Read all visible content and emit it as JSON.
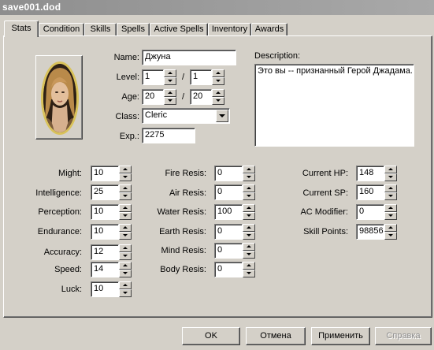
{
  "window": {
    "title": "save001.dod"
  },
  "tabs": [
    {
      "label": "Stats"
    },
    {
      "label": "Condition"
    },
    {
      "label": "Skills"
    },
    {
      "label": "Spells"
    },
    {
      "label": "Active Spells"
    },
    {
      "label": "Inventory"
    },
    {
      "label": "Awards"
    }
  ],
  "active_tab": "Stats",
  "character": {
    "name_label": "Name:",
    "name": "Джуна",
    "level_label": "Level:",
    "level": "1",
    "level_sep": "/",
    "level_max": "1",
    "age_label": "Age:",
    "age": "20",
    "age_sep": "/",
    "age_max": "20",
    "class_label": "Class:",
    "class": "Cleric",
    "exp_label": "Exp.:",
    "exp": "2275"
  },
  "description": {
    "label": "Description:",
    "text": "Это вы -- признанный Герой Джадама."
  },
  "attributes": [
    {
      "label": "Might:",
      "value": "10"
    },
    {
      "label": "Intelligence:",
      "value": "25"
    },
    {
      "label": "Perception:",
      "value": "10"
    },
    {
      "label": "Endurance:",
      "value": "10"
    },
    {
      "label": "Accuracy:",
      "value": "12"
    },
    {
      "label": "Speed:",
      "value": "14"
    },
    {
      "label": "Luck:",
      "value": "10"
    }
  ],
  "resistances": [
    {
      "label": "Fire Resis:",
      "value": "0"
    },
    {
      "label": "Air Resis:",
      "value": "0"
    },
    {
      "label": "Water Resis:",
      "value": "100"
    },
    {
      "label": "Earth Resis:",
      "value": "0"
    },
    {
      "label": "Mind Resis:",
      "value": "0"
    },
    {
      "label": "Body Resis:",
      "value": "0"
    }
  ],
  "status": [
    {
      "label": "Current HP:",
      "value": "148"
    },
    {
      "label": "Current SP:",
      "value": "160"
    },
    {
      "label": "AC Modifier:",
      "value": "0"
    },
    {
      "label": "Skill Points:",
      "value": "98856"
    }
  ],
  "buttons": {
    "ok": "OK",
    "cancel": "Отмена",
    "apply": "Применить",
    "help": "Справка"
  }
}
